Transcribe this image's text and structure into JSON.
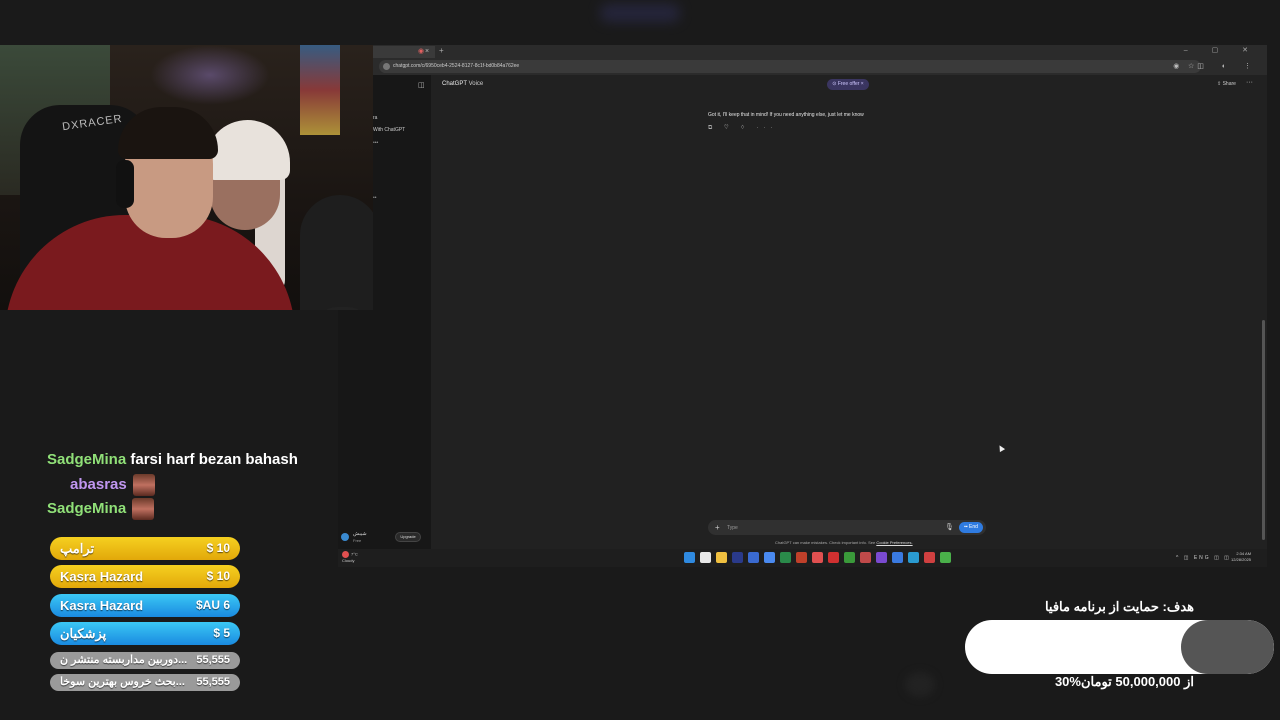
{
  "browser": {
    "tab_close": "×",
    "new_tab": "+",
    "window_buttons": "– ▢ ✕",
    "address": "chatgpt.com/c/6950ceb4-2524-8127-8c1f-bd0b84a762ee",
    "star_icon": "☆",
    "ext_icons": "◉ ◫ ◐ ⋮"
  },
  "sidebar": {
    "toggle_icon": "◫",
    "text1": "ra",
    "text2": "With ChatGPT",
    "text3": "•••",
    "text4": "••",
    "user_name": "شیبش",
    "user_plan": "Free",
    "upgrade_label": "Upgrade"
  },
  "chat": {
    "title": "ChatGPT",
    "mode": "Voice",
    "offer_label": "⊙ Free offer ×",
    "share_label": "⇪ Share",
    "more": "···",
    "message": "Got it, I'll keep that in mind! If you need anything else, just let me know",
    "message_actions": "⧉ ♡ ♢ ···",
    "composer_plus": "+",
    "composer_placeholder": "Type",
    "composer_mic": "🎙",
    "end_label": "▪▪ End",
    "disclaimer": "ChatGPT can make mistakes. Check important info. See",
    "disclaimer_link": "Cookie Preferences."
  },
  "taskbar": {
    "weather_temp": "7°C",
    "weather_desc": "Cloudy",
    "tray": "^ ◫ ENG ◫ ◫",
    "time": "2:34 AM",
    "date": "12/28/2025",
    "icon_colors": [
      "#2f8ae0",
      "#e8e8e8",
      "#f0c040",
      "#2a3a8a",
      "#3a6ad0",
      "#4a8af0",
      "#2a8a4a",
      "#c0402a",
      "#e05050",
      "#d03030",
      "#3a9a3a",
      "#c04a4a",
      "#7a4ad0",
      "#3a7ae0",
      "#2a9ad0",
      "#d04040",
      "#4ab04a"
    ]
  },
  "webcam": {
    "chair_brand": "DXRACER"
  },
  "stream_chat": [
    {
      "user": "SadgeMina",
      "message": "farsi harf bezan bahash",
      "color": "green",
      "emote": false
    },
    {
      "user": "abasras",
      "message": "",
      "color": "purple",
      "emote": true
    },
    {
      "user": "SadgeMina",
      "message": "",
      "color": "green",
      "emote": true
    }
  ],
  "donations": [
    {
      "name": "ترامپ",
      "amount": "$ 10",
      "style": "yellow"
    },
    {
      "name": "Kasra Hazard",
      "amount": "$ 10",
      "style": "yellow"
    },
    {
      "name": "Kasra Hazard",
      "amount": "$AU 6",
      "style": "blue"
    },
    {
      "name": "پزشکیان",
      "amount": "$ 5",
      "style": "blue"
    },
    {
      "name": "دوربین مداربسته منتشر ن...",
      "amount": "55,555",
      "style": "gray"
    },
    {
      "name": "بحث خروس بهترین سوخا...",
      "amount": "55,555",
      "style": "gray"
    }
  ],
  "goal": {
    "title": "هدف: حمایت از برنامه مافیا",
    "progress_fraction": 0.3,
    "text": "30%از 50,000,000 تومان"
  }
}
